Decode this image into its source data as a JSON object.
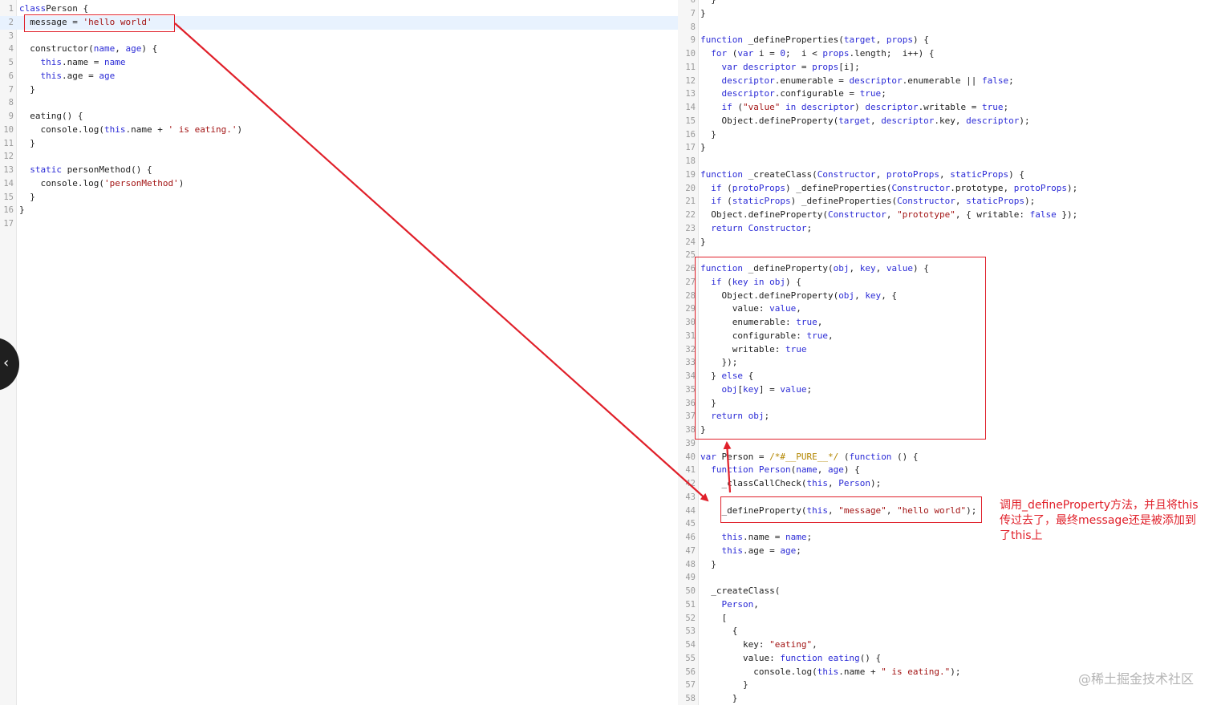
{
  "left_editor": {
    "lines": [
      {
        "n": "1",
        "t": [
          [
            "kw",
            "class"
          ],
          [
            "",
            "Person {"
          ]
        ]
      },
      {
        "n": "2",
        "t": [
          [
            "",
            "  message = "
          ],
          [
            "st",
            "'hello world'"
          ]
        ]
      },
      {
        "n": "3",
        "t": []
      },
      {
        "n": "4",
        "t": [
          [
            "",
            "  constructor("
          ],
          [
            "kw",
            "name"
          ],
          [
            "",
            ", "
          ],
          [
            "kw",
            "age"
          ],
          [
            "",
            ") {"
          ]
        ]
      },
      {
        "n": "5",
        "t": [
          [
            "",
            "    "
          ],
          [
            "kw",
            "this"
          ],
          [
            "",
            ".name = "
          ],
          [
            "kw",
            "name"
          ]
        ]
      },
      {
        "n": "6",
        "t": [
          [
            "",
            "    "
          ],
          [
            "kw",
            "this"
          ],
          [
            "",
            ".age = "
          ],
          [
            "kw",
            "age"
          ]
        ]
      },
      {
        "n": "7",
        "t": [
          [
            "",
            "  }"
          ]
        ]
      },
      {
        "n": "8",
        "t": []
      },
      {
        "n": "9",
        "t": [
          [
            "",
            "  eating() {"
          ]
        ]
      },
      {
        "n": "10",
        "t": [
          [
            "",
            "    console.log("
          ],
          [
            "kw",
            "this"
          ],
          [
            "",
            ".name + "
          ],
          [
            "st",
            "' is eating.'"
          ],
          [
            "",
            ")"
          ]
        ]
      },
      {
        "n": "11",
        "t": [
          [
            "",
            "  }"
          ]
        ]
      },
      {
        "n": "12",
        "t": []
      },
      {
        "n": "13",
        "t": [
          [
            "kw",
            "  static"
          ],
          [
            "",
            " personMethod() {"
          ]
        ]
      },
      {
        "n": "14",
        "t": [
          [
            "",
            "    console.log("
          ],
          [
            "st",
            "'personMethod'"
          ],
          [
            "",
            ")"
          ]
        ]
      },
      {
        "n": "15",
        "t": [
          [
            "",
            "  }"
          ]
        ]
      },
      {
        "n": "16",
        "t": [
          [
            "",
            "}"
          ]
        ]
      },
      {
        "n": "17",
        "t": []
      }
    ]
  },
  "right_editor": {
    "lines": [
      {
        "n": "6",
        "t": [
          [
            "",
            "  }"
          ]
        ]
      },
      {
        "n": "7",
        "t": [
          [
            "",
            "}"
          ]
        ]
      },
      {
        "n": "8",
        "t": []
      },
      {
        "n": "9",
        "t": [
          [
            "kw",
            "function"
          ],
          [
            "",
            " _defineProperties("
          ],
          [
            "kw",
            "target"
          ],
          [
            "",
            ", "
          ],
          [
            "kw",
            "props"
          ],
          [
            "",
            ") {"
          ]
        ]
      },
      {
        "n": "10",
        "t": [
          [
            "kw",
            "  for"
          ],
          [
            "",
            " ("
          ],
          [
            "kw",
            "var"
          ],
          [
            "",
            " i = "
          ],
          [
            "kw",
            "0"
          ],
          [
            "",
            ";  i < "
          ],
          [
            "kw",
            "props"
          ],
          [
            "",
            ".length;  i++) {"
          ]
        ]
      },
      {
        "n": "11",
        "t": [
          [
            "kw",
            "    var descriptor"
          ],
          [
            "",
            " = "
          ],
          [
            "kw",
            "props"
          ],
          [
            "",
            "[i];"
          ]
        ]
      },
      {
        "n": "12",
        "t": [
          [
            "kw",
            "    descriptor"
          ],
          [
            "",
            ".enumerable = "
          ],
          [
            "kw",
            "descriptor"
          ],
          [
            "",
            ".enumerable || "
          ],
          [
            "kw",
            "false"
          ],
          [
            "",
            ";"
          ]
        ]
      },
      {
        "n": "13",
        "t": [
          [
            "kw",
            "    descriptor"
          ],
          [
            "",
            ".configurable = "
          ],
          [
            "kw",
            "true"
          ],
          [
            "",
            ";"
          ]
        ]
      },
      {
        "n": "14",
        "t": [
          [
            "kw",
            "    if"
          ],
          [
            "",
            " ("
          ],
          [
            "st",
            "\"value\""
          ],
          [
            "kw",
            " in descriptor"
          ],
          [
            "",
            ") "
          ],
          [
            "kw",
            "descriptor"
          ],
          [
            "",
            ".writable = "
          ],
          [
            "kw",
            "true"
          ],
          [
            "",
            ";"
          ]
        ]
      },
      {
        "n": "15",
        "t": [
          [
            "",
            "    Object.defineProperty("
          ],
          [
            "kw",
            "target"
          ],
          [
            "",
            ", "
          ],
          [
            "kw",
            "descriptor"
          ],
          [
            "",
            ".key, "
          ],
          [
            "kw",
            "descriptor"
          ],
          [
            "",
            ");"
          ]
        ]
      },
      {
        "n": "16",
        "t": [
          [
            "",
            "  }"
          ]
        ]
      },
      {
        "n": "17",
        "t": [
          [
            "",
            "}"
          ]
        ]
      },
      {
        "n": "18",
        "t": []
      },
      {
        "n": "19",
        "t": [
          [
            "kw",
            "function"
          ],
          [
            "",
            " _createClass("
          ],
          [
            "kw",
            "Constructor"
          ],
          [
            "",
            ", "
          ],
          [
            "kw",
            "protoProps"
          ],
          [
            "",
            ", "
          ],
          [
            "kw",
            "staticProps"
          ],
          [
            "",
            ") {"
          ]
        ]
      },
      {
        "n": "20",
        "t": [
          [
            "kw",
            "  if"
          ],
          [
            "",
            " ("
          ],
          [
            "kw",
            "protoProps"
          ],
          [
            "",
            ") _defineProperties("
          ],
          [
            "kw",
            "Constructor"
          ],
          [
            "",
            ".prototype, "
          ],
          [
            "kw",
            "protoProps"
          ],
          [
            "",
            ");"
          ]
        ]
      },
      {
        "n": "21",
        "t": [
          [
            "kw",
            "  if"
          ],
          [
            "",
            " ("
          ],
          [
            "kw",
            "staticProps"
          ],
          [
            "",
            ") _defineProperties("
          ],
          [
            "kw",
            "Constructor"
          ],
          [
            "",
            ", "
          ],
          [
            "kw",
            "staticProps"
          ],
          [
            "",
            ");"
          ]
        ]
      },
      {
        "n": "22",
        "t": [
          [
            "",
            "  Object.defineProperty("
          ],
          [
            "kw",
            "Constructor"
          ],
          [
            "",
            ", "
          ],
          [
            "st",
            "\"prototype\""
          ],
          [
            "",
            ", { writable: "
          ],
          [
            "kw",
            "false"
          ],
          [
            "",
            " });"
          ]
        ]
      },
      {
        "n": "23",
        "t": [
          [
            "kw",
            "  return Constructor"
          ],
          [
            "",
            ";"
          ]
        ]
      },
      {
        "n": "24",
        "t": [
          [
            "",
            "}"
          ]
        ]
      },
      {
        "n": "25",
        "t": []
      },
      {
        "n": "26",
        "t": [
          [
            "kw",
            "function"
          ],
          [
            "",
            " _defineProperty("
          ],
          [
            "kw",
            "obj"
          ],
          [
            "",
            ", "
          ],
          [
            "kw",
            "key"
          ],
          [
            "",
            ", "
          ],
          [
            "kw",
            "value"
          ],
          [
            "",
            ") {"
          ]
        ]
      },
      {
        "n": "27",
        "t": [
          [
            "kw",
            "  if"
          ],
          [
            "",
            " ("
          ],
          [
            "kw",
            "key in obj"
          ],
          [
            "",
            ") {"
          ]
        ]
      },
      {
        "n": "28",
        "t": [
          [
            "",
            "    Object.defineProperty("
          ],
          [
            "kw",
            "obj"
          ],
          [
            "",
            ", "
          ],
          [
            "kw",
            "key"
          ],
          [
            "",
            ", {"
          ]
        ]
      },
      {
        "n": "29",
        "t": [
          [
            "",
            "      value: "
          ],
          [
            "kw",
            "value"
          ],
          [
            "",
            ","
          ]
        ]
      },
      {
        "n": "30",
        "t": [
          [
            "",
            "      enumerable: "
          ],
          [
            "kw",
            "true"
          ],
          [
            "",
            ","
          ]
        ]
      },
      {
        "n": "31",
        "t": [
          [
            "",
            "      configurable: "
          ],
          [
            "kw",
            "true"
          ],
          [
            "",
            ","
          ]
        ]
      },
      {
        "n": "32",
        "t": [
          [
            "",
            "      writable: "
          ],
          [
            "kw",
            "true"
          ]
        ]
      },
      {
        "n": "33",
        "t": [
          [
            "",
            "    });"
          ]
        ]
      },
      {
        "n": "34",
        "t": [
          [
            "",
            "  } "
          ],
          [
            "kw",
            "else"
          ],
          [
            "",
            " {"
          ]
        ]
      },
      {
        "n": "35",
        "t": [
          [
            "kw",
            "    obj"
          ],
          [
            "",
            "["
          ],
          [
            "kw",
            "key"
          ],
          [
            "",
            "] = "
          ],
          [
            "kw",
            "value"
          ],
          [
            "",
            ";"
          ]
        ]
      },
      {
        "n": "36",
        "t": [
          [
            "",
            "  }"
          ]
        ]
      },
      {
        "n": "37",
        "t": [
          [
            "kw",
            "  return obj"
          ],
          [
            "",
            ";"
          ]
        ]
      },
      {
        "n": "38",
        "t": [
          [
            "",
            "}"
          ]
        ]
      },
      {
        "n": "39",
        "t": []
      },
      {
        "n": "40",
        "t": [
          [
            "kw",
            "var"
          ],
          [
            "",
            " Person = "
          ],
          [
            "cm",
            "/*#__PURE__*/"
          ],
          [
            "",
            " ("
          ],
          [
            "kw",
            "function"
          ],
          [
            "",
            " () {"
          ]
        ]
      },
      {
        "n": "41",
        "t": [
          [
            "kw",
            "  function"
          ],
          [
            "kw",
            " Person"
          ],
          [
            "",
            "("
          ],
          [
            "kw",
            "name"
          ],
          [
            "",
            ", "
          ],
          [
            "kw",
            "age"
          ],
          [
            "",
            ") {"
          ]
        ]
      },
      {
        "n": "42",
        "t": [
          [
            "",
            "    _classCallCheck("
          ],
          [
            "kw",
            "this"
          ],
          [
            "",
            ", "
          ],
          [
            "kw",
            "Person"
          ],
          [
            "",
            ");"
          ]
        ]
      },
      {
        "n": "43",
        "t": []
      },
      {
        "n": "44",
        "t": [
          [
            "",
            "    _defineProperty("
          ],
          [
            "kw",
            "this"
          ],
          [
            "",
            ", "
          ],
          [
            "st",
            "\"message\""
          ],
          [
            "",
            ", "
          ],
          [
            "st",
            "\"hello world\""
          ],
          [
            "",
            ");"
          ]
        ]
      },
      {
        "n": "45",
        "t": []
      },
      {
        "n": "46",
        "t": [
          [
            "kw",
            "    this"
          ],
          [
            "",
            ".name = "
          ],
          [
            "kw",
            "name"
          ],
          [
            "",
            ";"
          ]
        ]
      },
      {
        "n": "47",
        "t": [
          [
            "kw",
            "    this"
          ],
          [
            "",
            ".age = "
          ],
          [
            "kw",
            "age"
          ],
          [
            "",
            ";"
          ]
        ]
      },
      {
        "n": "48",
        "t": [
          [
            "",
            "  }"
          ]
        ]
      },
      {
        "n": "49",
        "t": []
      },
      {
        "n": "50",
        "t": [
          [
            "",
            "  _createClass("
          ]
        ]
      },
      {
        "n": "51",
        "t": [
          [
            "kw",
            "    Person"
          ],
          [
            "",
            ","
          ]
        ]
      },
      {
        "n": "52",
        "t": [
          [
            "",
            "    ["
          ]
        ]
      },
      {
        "n": "53",
        "t": [
          [
            "",
            "      {"
          ]
        ]
      },
      {
        "n": "54",
        "t": [
          [
            "",
            "        key: "
          ],
          [
            "st",
            "\"eating\""
          ],
          [
            "",
            ","
          ]
        ]
      },
      {
        "n": "55",
        "t": [
          [
            "",
            "        value: "
          ],
          [
            "kw",
            "function eating"
          ],
          [
            "",
            "() {"
          ]
        ]
      },
      {
        "n": "56",
        "t": [
          [
            "",
            "          console.log("
          ],
          [
            "kw",
            "this"
          ],
          [
            "",
            ".name + "
          ],
          [
            "st",
            "\" is eating.\""
          ],
          [
            "",
            ");"
          ]
        ]
      },
      {
        "n": "57",
        "t": [
          [
            "",
            "        }"
          ]
        ]
      },
      {
        "n": "58",
        "t": [
          [
            "",
            "      }"
          ]
        ]
      }
    ]
  },
  "annotation_text": "调用_defineProperty方法，并且将this传过去了，最终message还是被添加到了this上",
  "watermark_text": "@稀土掘金技术社区",
  "colors": {
    "annotation": "#e0202a",
    "keyword": "#2b2bd6",
    "string": "#a31515"
  },
  "icons": {
    "side_button": "chevron-left-icon"
  }
}
